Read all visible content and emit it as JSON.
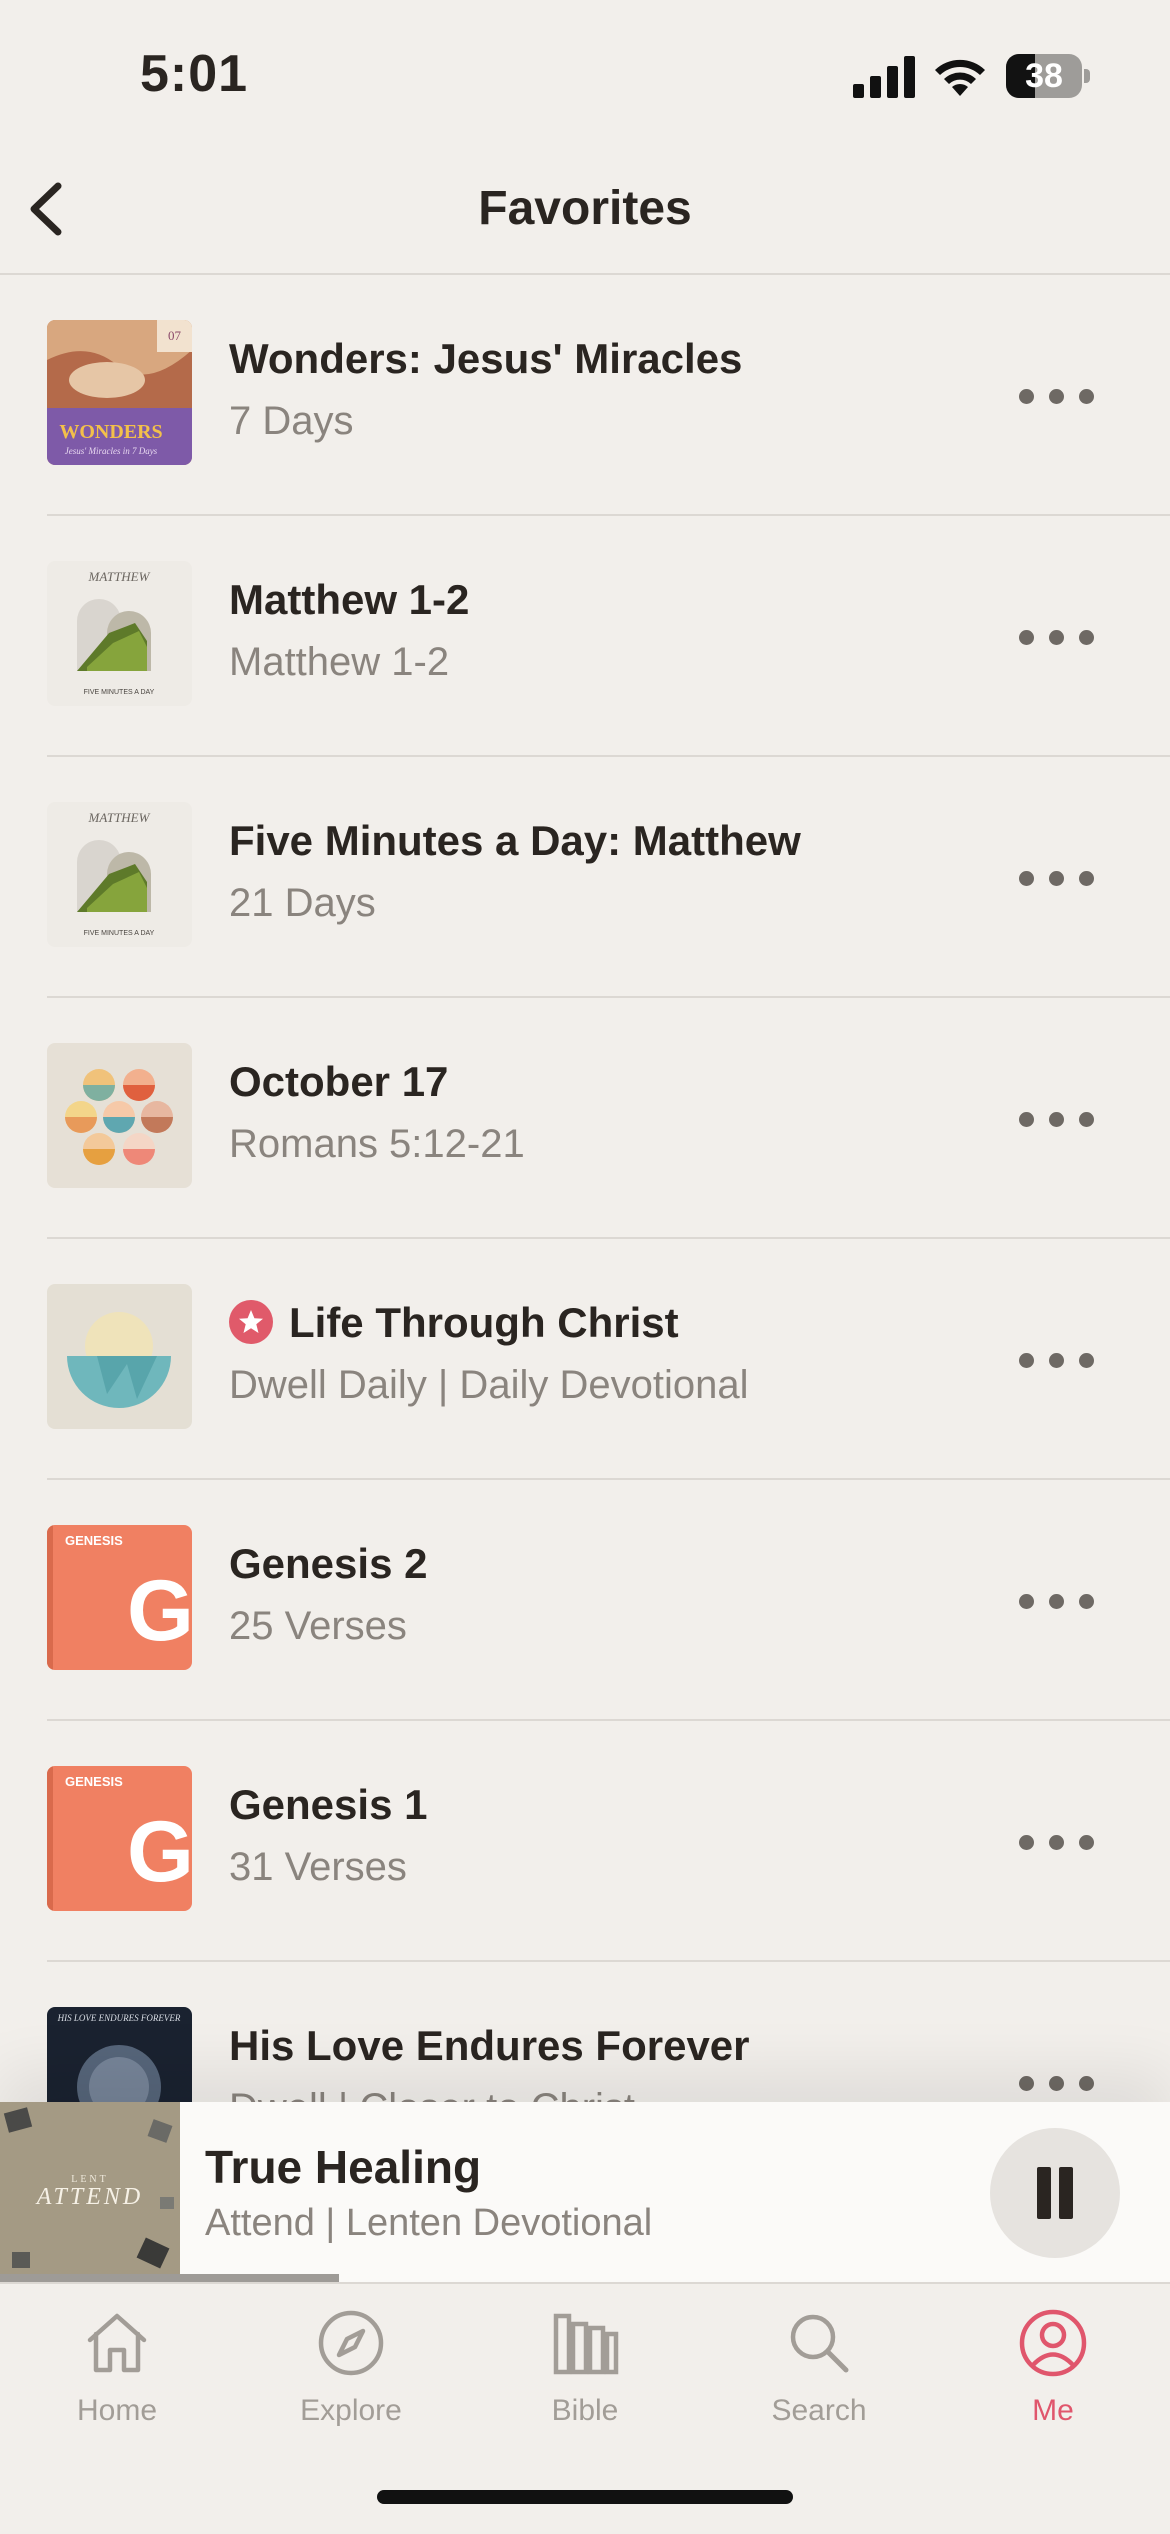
{
  "status_bar": {
    "time": "5:01",
    "battery": "38",
    "battery_level": 0.38
  },
  "header": {
    "title": "Favorites",
    "back_icon": "chevron-left-icon"
  },
  "favorites": [
    {
      "title": "Wonders: Jesus' Miracles",
      "subtitle": "7 Days",
      "art": {
        "word": "WONDERS",
        "caption": "Jesus' Miracles in 7 Days",
        "badge": "07"
      }
    },
    {
      "title": "Matthew 1-2",
      "subtitle": "Matthew 1-2",
      "art": {
        "word": "MATTHEW",
        "caption": "FIVE MINUTES A DAY"
      }
    },
    {
      "title": "Five Minutes a Day: Matthew",
      "subtitle": "21 Days",
      "art": {
        "word": "MATTHEW",
        "caption": "FIVE MINUTES A DAY"
      }
    },
    {
      "title": "October 17",
      "subtitle": "Romans 5:12-21"
    },
    {
      "title": "Life Through Christ",
      "subtitle": "Dwell Daily | Daily Devotional",
      "badge_icon": "star-icon"
    },
    {
      "title": "Genesis 2",
      "subtitle": "25 Verses",
      "art": {
        "word": "GENESIS",
        "letter": "G"
      }
    },
    {
      "title": "Genesis 1",
      "subtitle": "31 Verses",
      "art": {
        "word": "GENESIS",
        "letter": "G"
      }
    },
    {
      "title": "His Love Endures Forever",
      "subtitle": "Dwell | Closer to Christ",
      "art": {
        "word": "HIS LOVE ENDURES FOREVER"
      }
    }
  ],
  "player": {
    "title": "True Healing",
    "subtitle": "Attend | Lenten Devotional",
    "art": {
      "kicker": "LENT",
      "word": "ATTEND"
    },
    "progress": 0.29,
    "pause_icon": "pause-icon"
  },
  "tabs": [
    {
      "label": "Home",
      "icon": "home-icon",
      "active": false
    },
    {
      "label": "Explore",
      "icon": "compass-icon",
      "active": false
    },
    {
      "label": "Bible",
      "icon": "bible-icon",
      "active": false
    },
    {
      "label": "Search",
      "icon": "search-icon",
      "active": false
    },
    {
      "label": "Me",
      "icon": "profile-icon",
      "active": true
    }
  ],
  "colors": {
    "accent": "#e0566c",
    "background": "#f2efeb",
    "text": "#2a2521",
    "muted": "#8a847e",
    "genesis": "#f08062"
  }
}
